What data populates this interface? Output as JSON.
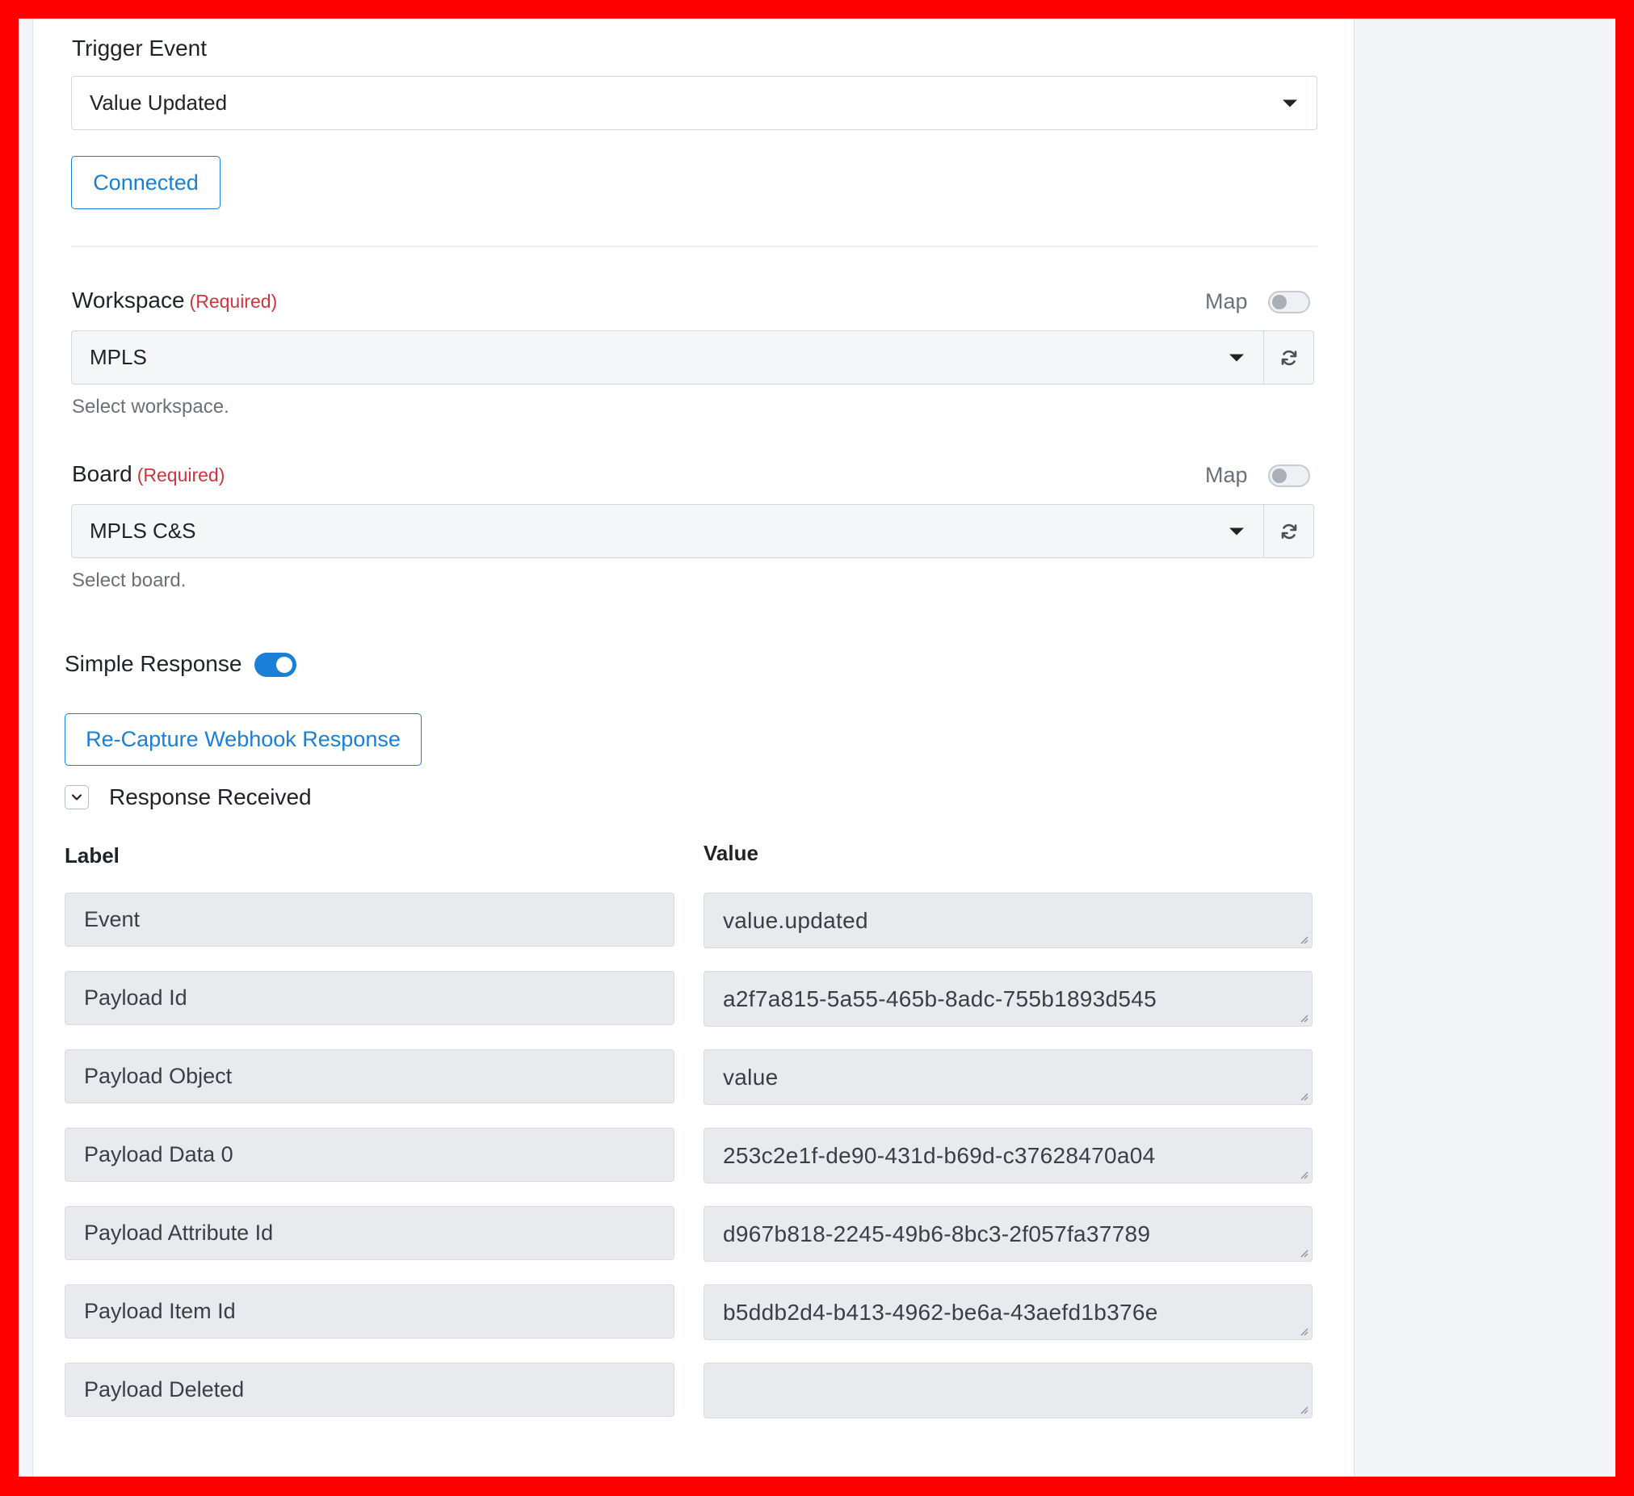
{
  "trigger": {
    "label": "Trigger Event",
    "selected": "Value Updated",
    "connect_button": "Connected"
  },
  "workspace": {
    "label": "Workspace",
    "required": "(Required)",
    "map_label": "Map",
    "selected": "MPLS",
    "help": "Select workspace."
  },
  "board": {
    "label": "Board",
    "required": "(Required)",
    "map_label": "Map",
    "selected": "MPLS C&S",
    "help": "Select board."
  },
  "simple_response": {
    "label": "Simple Response",
    "enabled": true
  },
  "recapture_button": "Re-Capture Webhook Response",
  "response_received": "Response Received",
  "table": {
    "label_header": "Label",
    "value_header": "Value",
    "rows": [
      {
        "label": "Event",
        "value": "value.updated"
      },
      {
        "label": "Payload Id",
        "value": "a2f7a815-5a55-465b-8adc-755b1893d545"
      },
      {
        "label": "Payload Object",
        "value": "value"
      },
      {
        "label": "Payload Data 0",
        "value": "253c2e1f-de90-431d-b69d-c37628470a04"
      },
      {
        "label": "Payload Attribute Id",
        "value": "d967b818-2245-49b6-8bc3-2f057fa37789"
      },
      {
        "label": "Payload Item Id",
        "value": "b5ddb2d4-b413-4962-be6a-43aefd1b376e"
      },
      {
        "label": "Payload Deleted",
        "value": ""
      }
    ]
  },
  "colors": {
    "frame": "#ff0000",
    "accent": "#1a7fd6",
    "required": "#d0353f"
  }
}
